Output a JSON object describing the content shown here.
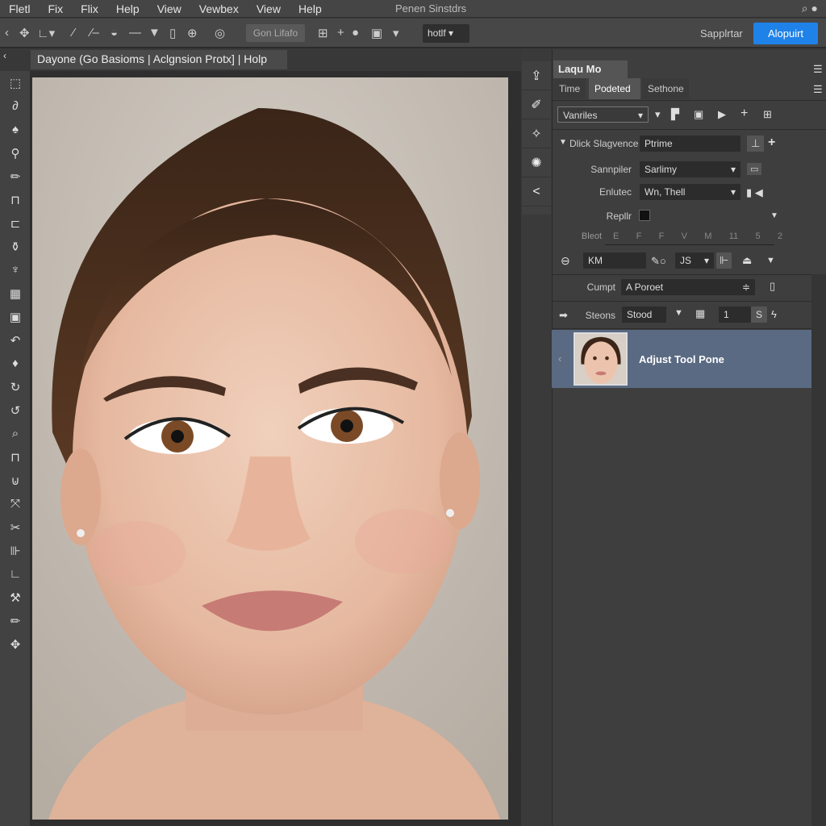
{
  "menubar": {
    "items": [
      "Fletl",
      "Fix",
      "Flix",
      "Help",
      "View",
      "Vewbex",
      "View",
      "Help"
    ],
    "title": "Penen Sinstdrs"
  },
  "toolbar": {
    "button_label": "Gon Lifafo",
    "select_value": "hotlf",
    "secondary_label": "Sapplrtar",
    "primary_label": "Alopuirt"
  },
  "document": {
    "tab_label": "Dayone (Go Basioms | Aclgnsion Protx] | Holp"
  },
  "left_tools": [
    "selection-icon",
    "lasso-icon",
    "brush-icon",
    "clone-stamp-icon",
    "pencil-icon",
    "crop-icon",
    "marquee-icon",
    "stamp-icon",
    "pen-icon",
    "grid-icon",
    "rect-select-icon",
    "curve-icon",
    "dodge-icon",
    "rotate-icon",
    "history-icon",
    "zoom-icon",
    "ruler-icon",
    "move-icon",
    "transform-icon",
    "scissors-icon",
    "slice-icon",
    "line-icon",
    "eyedropper-icon",
    "pencil-icon",
    "healing-icon"
  ],
  "panel": {
    "title": "Laqu Mo",
    "tabs": [
      "Time",
      "Podeted",
      "Sethone"
    ],
    "active_tab": 1,
    "preset_select": "Vanriles",
    "section_label": "Dlick Slagvence",
    "section_value": "Ptrime",
    "rows": [
      {
        "label": "Sannpiler",
        "value": "Sarlimy"
      },
      {
        "label": "Enlutec",
        "value": "Wn, Thell"
      },
      {
        "label": "Repllr",
        "value": ""
      }
    ],
    "scale_label": "Bleot",
    "scale_values": [
      "E",
      "F",
      "F",
      "V",
      "M",
      "11",
      "5",
      "2"
    ],
    "km_field": "KM",
    "js_select": "JS",
    "compt_label": "Cumpt",
    "compt_value": "A Poroet",
    "steps_label": "Steons",
    "steps_value": "Stood",
    "steps_number": "1",
    "steps_unit": "S",
    "layer_name": "Adjust Tool Pone"
  },
  "colors": {
    "accent": "#1f82e8",
    "layer_selected": "#5a6a82",
    "panel": "#3e3e3e"
  }
}
